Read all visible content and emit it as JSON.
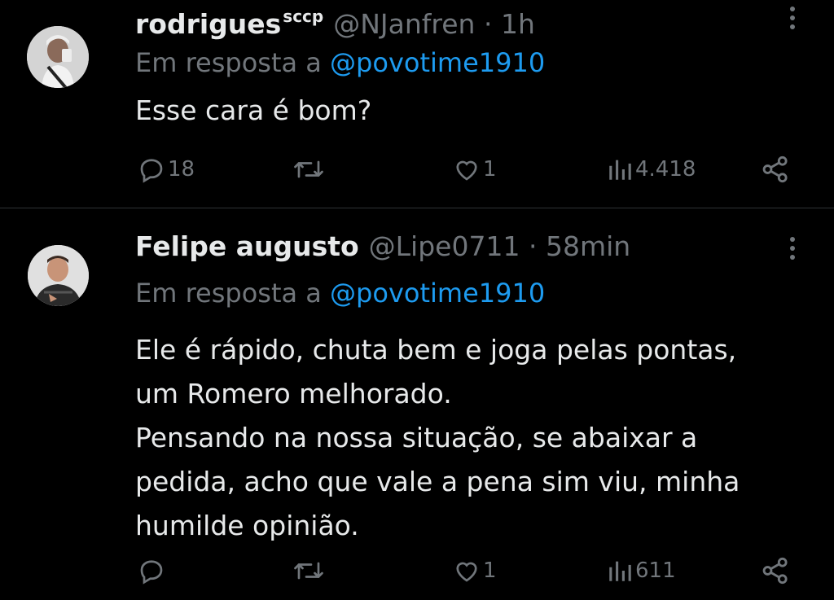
{
  "tweets": [
    {
      "display_name": "rodrigues",
      "name_badge": "sccp",
      "handle": "@NJanfren",
      "separator": "·",
      "time": "1h",
      "reply_prefix": "Em resposta a",
      "reply_to": "@povotime1910",
      "body": [
        "Esse cara é bom?"
      ],
      "stats": {
        "replies": "18",
        "retweets": "",
        "likes": "1",
        "views": "4.418"
      }
    },
    {
      "display_name": "Felipe augusto",
      "handle": "@Lipe0711",
      "separator": "·",
      "time": "58min",
      "reply_prefix": "Em resposta a",
      "reply_to": "@povotime1910",
      "body": [
        "Ele é rápido, chuta bem e joga pelas pontas,",
        "um Romero melhorado.",
        "Pensando na nossa situação, se abaixar a",
        "pedida, acho que vale a pena sim viu, minha",
        "humilde opinião."
      ],
      "stats": {
        "replies": "",
        "retweets": "",
        "likes": "1",
        "views": "611"
      }
    }
  ],
  "icons": {
    "reply": "speech-bubble",
    "retweet": "two-arrows-loop",
    "like": "heart",
    "views": "bar-chart",
    "share": "share-nodes",
    "more": "vertical-ellipsis"
  },
  "colors": {
    "background": "#000000",
    "text": "#e7e9ea",
    "muted": "#71767b",
    "link": "#1d9bf0",
    "divider": "#2f3336"
  }
}
